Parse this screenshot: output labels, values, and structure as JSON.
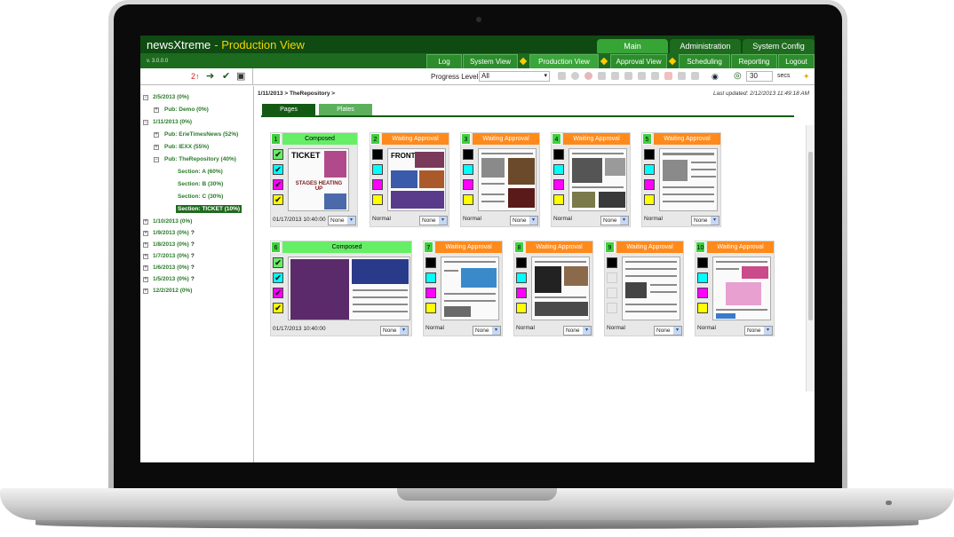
{
  "app": {
    "brand": "newsXtreme",
    "view": "- Production View",
    "version": "v. 3.0.0.0"
  },
  "main_tabs": [
    {
      "label": "Main",
      "active": true
    },
    {
      "label": "Administration",
      "active": false
    },
    {
      "label": "System Config",
      "active": false
    }
  ],
  "nav_tabs": [
    {
      "label": "Log",
      "active": false
    },
    {
      "label": "System View",
      "active": false
    },
    {
      "label": "Production View",
      "active": true
    },
    {
      "label": "Approval View",
      "active": false
    },
    {
      "label": "Scheduling",
      "active": false
    },
    {
      "label": "Reporting",
      "active": false
    },
    {
      "label": "Logout",
      "active": false
    }
  ],
  "toolbar": {
    "progress_label": "Progress Level",
    "progress_value": "All",
    "refresh_value": "30",
    "refresh_unit": "secs"
  },
  "tree": [
    {
      "label": "2/5/2013 (0%)"
    },
    {
      "label": "Pub: Demo (0%)"
    },
    {
      "label": "1/11/2013 (0%)"
    },
    {
      "label": "Pub: ErieTimesNews (52%)"
    },
    {
      "label": "Pub: IEXX (55%)"
    },
    {
      "label": "Pub: TheRepository (40%)"
    },
    {
      "label": "Section: A (60%)"
    },
    {
      "label": "Section: B (30%)"
    },
    {
      "label": "Section: C (30%)"
    },
    {
      "label": "Section: TICKET (10%)"
    },
    {
      "label": "1/10/2013 (0%)"
    },
    {
      "label": "1/9/2013 (0%)"
    },
    {
      "label": "1/8/2013 (0%)"
    },
    {
      "label": "1/7/2013 (0%)"
    },
    {
      "label": "1/6/2013 (0%)"
    },
    {
      "label": "1/5/2013 (0%)"
    },
    {
      "label": "12/2/2012 (0%)"
    }
  ],
  "tree_qmark": "?",
  "content": {
    "breadcrumb": "1/11/2013 > TheRepository >",
    "last_updated": "Last updated: 2/12/2013 11:49:18 AM",
    "tabs": [
      {
        "label": "Pages",
        "active": true
      },
      {
        "label": "Plates",
        "active": false
      }
    ]
  },
  "pages": [
    {
      "num": "1",
      "status": "Composed",
      "time": "01/17/2013 10:40:00",
      "note": "",
      "select": "None"
    },
    {
      "num": "2",
      "status": "Waiting Approval",
      "time": "",
      "note": "Normal",
      "select": "None"
    },
    {
      "num": "3",
      "status": "Waiting Approval",
      "time": "",
      "note": "Normal",
      "select": "None"
    },
    {
      "num": "4",
      "status": "Waiting Approval",
      "time": "",
      "note": "Normal",
      "select": "None"
    },
    {
      "num": "5",
      "status": "Waiting Approval",
      "time": "",
      "note": "Normal",
      "select": "None"
    },
    {
      "num": "6",
      "status": "Composed",
      "time": "01/17/2013 10:40:00",
      "note": "",
      "select": "None"
    },
    {
      "num": "7",
      "status": "Waiting Approval",
      "time": "",
      "note": "Normal",
      "select": "None"
    },
    {
      "num": "8",
      "status": "Waiting Approval",
      "time": "",
      "note": "Normal",
      "select": "None"
    },
    {
      "num": "9",
      "status": "Waiting Approval",
      "time": "",
      "note": "Normal",
      "select": "None"
    },
    {
      "num": "10",
      "status": "Waiting Approval",
      "time": "",
      "note": "Normal",
      "select": "None"
    }
  ],
  "thumb_labels": {
    "p1_headline": "TICKET",
    "p1_sub": "STAGES HEATING UP",
    "p2_headline": "FRONT"
  },
  "colors": {
    "header_green": "#0f4a12",
    "tab_green": "#36a536",
    "composed": "#66ee66",
    "waiting": "#ff8a1c",
    "swatch_black": "#000000",
    "swatch_cyan": "#00ffff",
    "swatch_magenta": "#ff00ff",
    "swatch_yellow": "#ffff00"
  }
}
